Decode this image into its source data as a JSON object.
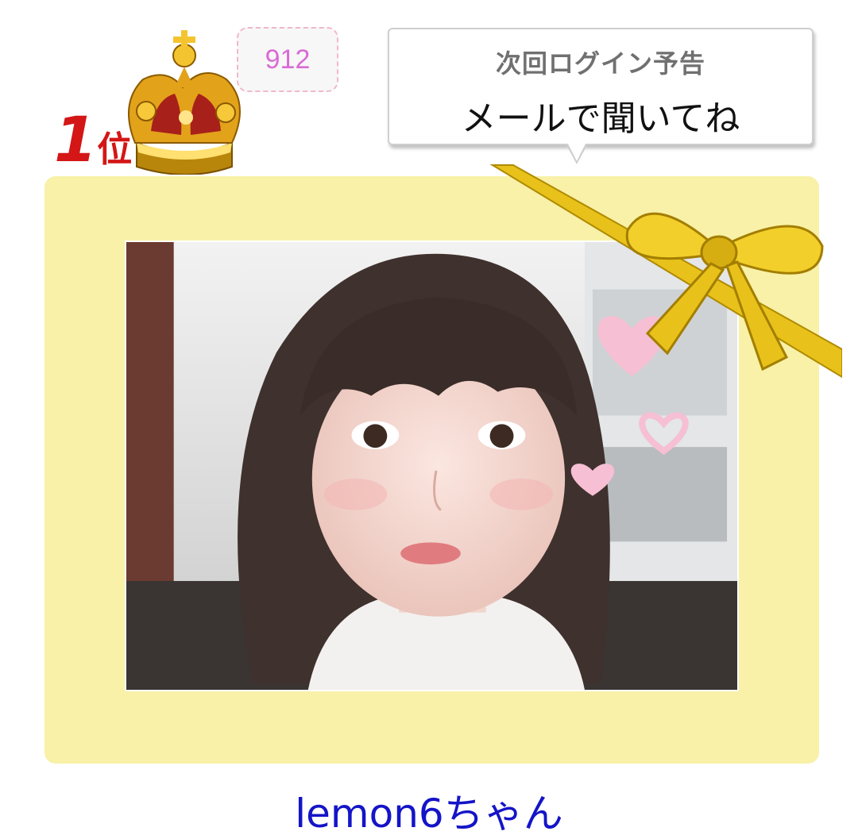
{
  "rank": {
    "number": "1",
    "suffix": "位",
    "icon": "crown-icon"
  },
  "count": {
    "value": "912"
  },
  "login_notice": {
    "heading": "次回ログイン予告",
    "message": "メールで聞いてね"
  },
  "profile": {
    "username": "lemon6ちゃん",
    "photo_icon": "profile-photo",
    "decoration_icon": "gold-ribbon-icon"
  },
  "colors": {
    "card_background": "#f8f1a7",
    "username_link": "#1414c8",
    "rank_red": "#d41616",
    "count_pink": "#d96bd6",
    "ribbon_gold": "#e8c21b"
  }
}
